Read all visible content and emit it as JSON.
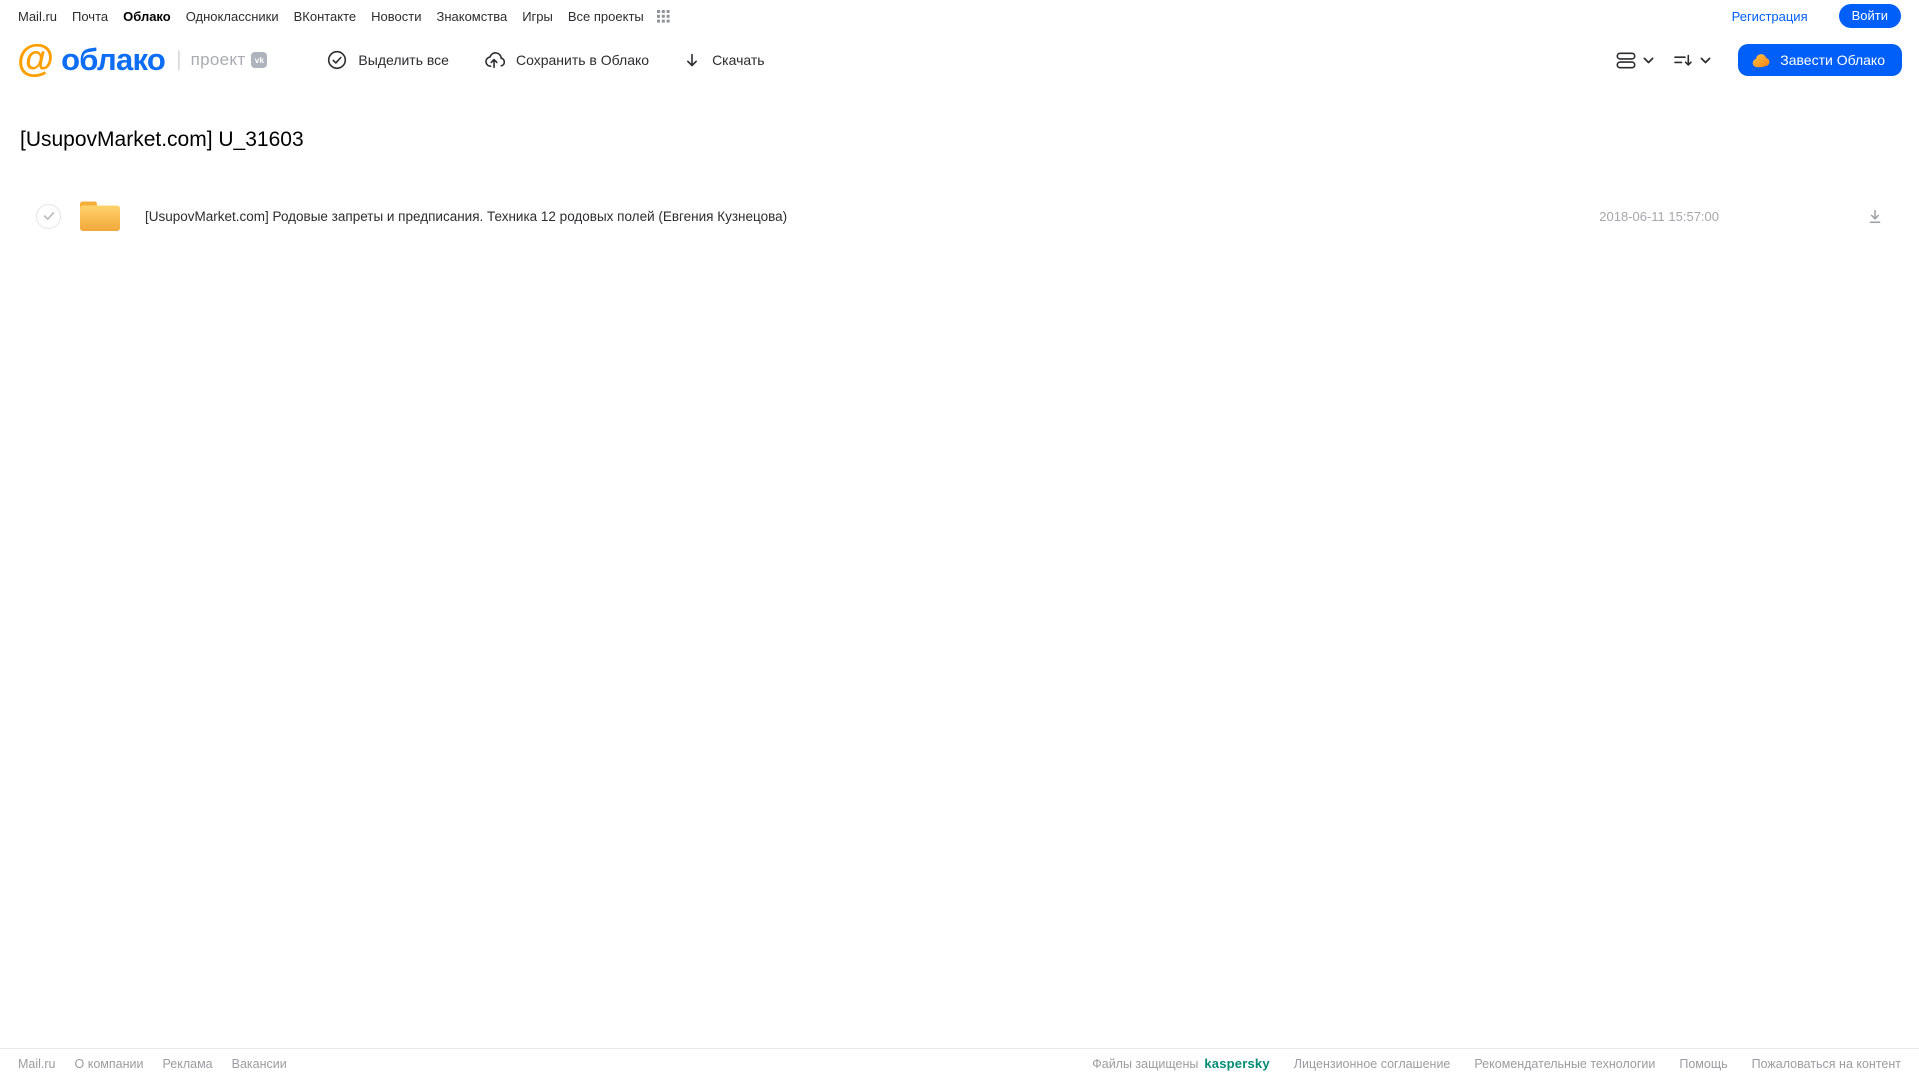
{
  "topnav": {
    "items": [
      "Mail.ru",
      "Почта",
      "Облако",
      "Одноклассники",
      "ВКонтакте",
      "Новости",
      "Знакомства",
      "Игры",
      "Все проекты"
    ],
    "active_item": "Облако",
    "register": "Регистрация",
    "login": "Войти"
  },
  "header": {
    "logo": {
      "at": "@",
      "name": "облако",
      "separator": "|",
      "project": "проект",
      "vk_badge": "vk"
    },
    "actions": {
      "select_all": "Выделить все",
      "save_to_cloud": "Сохранить в Облако",
      "download": "Скачать"
    },
    "create_cloud": "Завести Облако"
  },
  "main": {
    "title": "[UsupovMarket.com] U_31603",
    "files": [
      {
        "name": "[UsupovMarket.com] Родовые запреты и предписания. Техника 12 родовых полей (Евгения Кузнецова)",
        "date": "2018-06-11 15:57:00",
        "type": "folder"
      }
    ]
  },
  "footer": {
    "left": [
      "Mail.ru",
      "О компании",
      "Реклама",
      "Вакансии"
    ],
    "protected_label": "Файлы защищены",
    "kaspersky": "kaspersky",
    "right": [
      "Лицензионное соглашение",
      "Рекомендательные технологии",
      "Помощь",
      "Пожаловаться на контент"
    ]
  },
  "icons": {
    "apps_grid": "apps-grid-icon",
    "select_all": "check-circle-icon",
    "save": "cloud-upload-icon",
    "download": "arrow-down-icon",
    "view_mode": "rows-view-icon",
    "sort": "sort-arrow-icon",
    "chevron": "chevron-down-icon",
    "button_cloud": "cloud-icon",
    "file": "folder-icon",
    "row_download": "download-icon"
  },
  "colors": {
    "accent_blue": "#005FF9",
    "logo_orange": "#FF9E00",
    "logo_blue": "#0D6EF5",
    "folder_yellow": "#F6AE3B",
    "cloud_button_orange": "#F6820C",
    "kaspersky_green": "#008C72",
    "muted_gray": "#9a9da2"
  }
}
